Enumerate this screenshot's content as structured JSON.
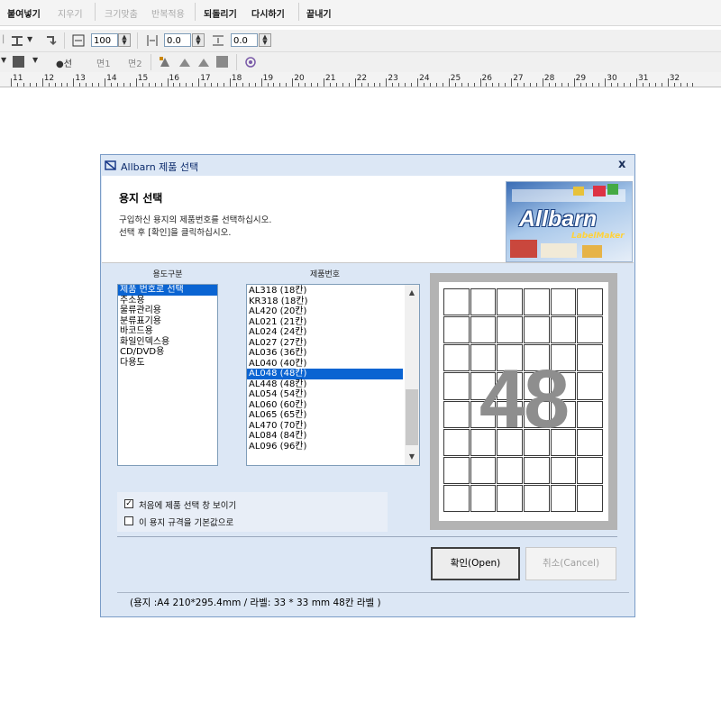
{
  "menubar": {
    "paste": "붙여넣기",
    "delete": "지우기",
    "fit_size": "크기맞춤",
    "apply_repeat": "반복적용",
    "undo": "되돌리기",
    "redo": "다시하기",
    "exit": "끝내기"
  },
  "toolbar": {
    "width_value": "100",
    "spacing_x": "0.0",
    "spacing_y": "0.0",
    "line_label": "●선",
    "face1_label": "면1",
    "face2_label": "면2"
  },
  "ruler": {
    "labels": [
      "11",
      "12",
      "13",
      "14",
      "15",
      "16",
      "17",
      "18",
      "19",
      "20",
      "21",
      "22",
      "23",
      "24",
      "25",
      "26",
      "27",
      "28",
      "29",
      "30",
      "31",
      "32"
    ]
  },
  "dialog": {
    "title": "Allbarn 제품 선택",
    "close": "x",
    "header_title": "용지 선택",
    "header_line1": "구입하신 용지의 제품번호를 선택하십시오.",
    "header_line2": "선택 후 [확인]을 클릭하십시오.",
    "logo_text": "Allbarn",
    "logo_subtext": "LabelMaker",
    "usage_header": "용도구분",
    "product_header": "제품번호",
    "usage_items": [
      {
        "label": "제품 번호로 선택",
        "selected": true
      },
      {
        "label": "주소용",
        "selected": false
      },
      {
        "label": "물류관리용",
        "selected": false
      },
      {
        "label": "분류표기용",
        "selected": false
      },
      {
        "label": "바코드용",
        "selected": false
      },
      {
        "label": "화일인덱스용",
        "selected": false
      },
      {
        "label": "CD/DVD용",
        "selected": false
      },
      {
        "label": "다용도",
        "selected": false
      }
    ],
    "product_items": [
      {
        "label": "AL318 (18칸)",
        "selected": false
      },
      {
        "label": "KR318 (18칸)",
        "selected": false
      },
      {
        "label": "AL420 (20칸)",
        "selected": false
      },
      {
        "label": "AL021 (21칸)",
        "selected": false
      },
      {
        "label": "AL024 (24칸)",
        "selected": false
      },
      {
        "label": "AL027 (27칸)",
        "selected": false
      },
      {
        "label": "AL036 (36칸)",
        "selected": false
      },
      {
        "label": "AL040 (40칸)",
        "selected": false
      },
      {
        "label": "AL048 (48칸)",
        "selected": true
      },
      {
        "label": "AL448 (48칸)",
        "selected": false
      },
      {
        "label": "AL054 (54칸)",
        "selected": false
      },
      {
        "label": "AL060 (60칸)",
        "selected": false
      },
      {
        "label": "AL065 (65칸)",
        "selected": false
      },
      {
        "label": "AL470 (70칸)",
        "selected": false
      },
      {
        "label": "AL084 (84칸)",
        "selected": false
      },
      {
        "label": "AL096 (96칸)",
        "selected": false
      }
    ],
    "preview": {
      "count_label": "48",
      "columns": 6,
      "rows": 8
    },
    "checkbox1": {
      "label": "처음에 제품 선택 창 보이기",
      "checked": true,
      "mark": "✓"
    },
    "checkbox2": {
      "label": "이 용지 규격을 기본값으로",
      "checked": false,
      "mark": ""
    },
    "ok_button": "확인(Open)",
    "cancel_button": "취소(Cancel)",
    "status": "(용지 :A4 210*295.4mm / 라벨: 33 * 33 mm  48칸 라벨 )"
  },
  "colors": {
    "dialog_bg": "#dce7f5",
    "selection": "#0a64d2",
    "preview_number": "#8e8e8e"
  }
}
